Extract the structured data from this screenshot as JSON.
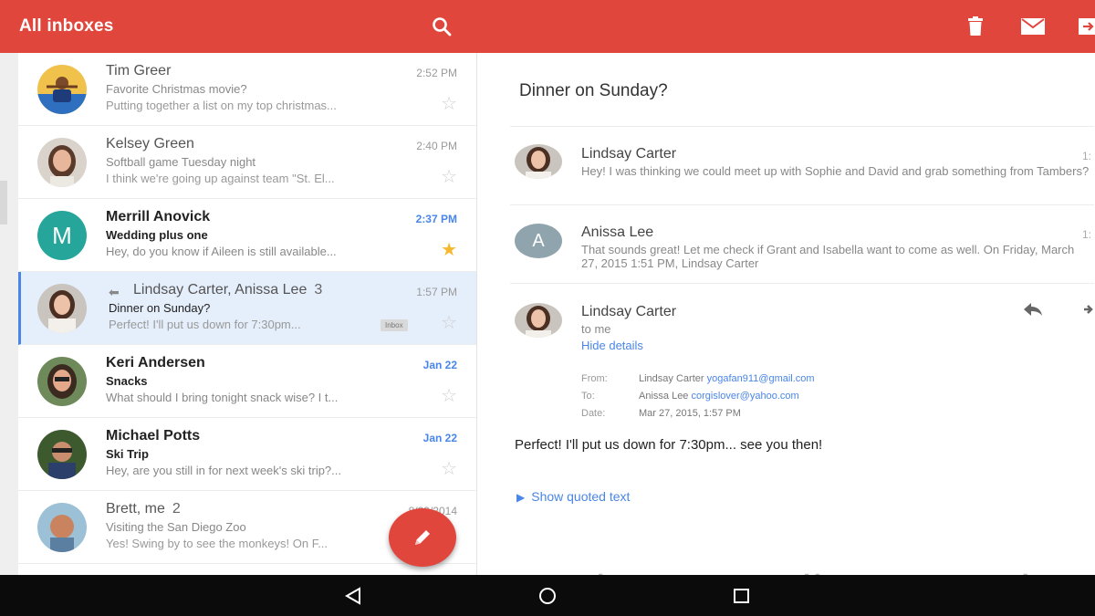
{
  "app_bar": {
    "title": "All inboxes",
    "accent_color": "#e0463c",
    "icons": [
      "search-icon",
      "delete-icon",
      "mark-unread-icon",
      "move-icon"
    ]
  },
  "threads": [
    {
      "sender": "Tim Greer",
      "count": "",
      "time": "2:52 PM",
      "subject": "Favorite Christmas movie?",
      "snippet": "Putting together a list on my top christmas...",
      "unread": false,
      "starred": false,
      "avatar": "photo",
      "chip": ""
    },
    {
      "sender": "Kelsey Green",
      "count": "",
      "time": "2:40 PM",
      "subject": "Softball game Tuesday night",
      "snippet": "I think we're going up against team \"St. El...",
      "unread": false,
      "starred": false,
      "avatar": "photo",
      "chip": ""
    },
    {
      "sender": "Merrill Anovick",
      "count": "",
      "time": "2:37 PM",
      "subject": "Wedding plus one",
      "snippet": "Hey, do you know if Aileen is still available...",
      "unread": true,
      "starred": true,
      "avatar": "M",
      "chip": ""
    },
    {
      "sender": "Lindsay Carter, Anissa Lee",
      "count": "3",
      "time": "1:57 PM",
      "subject": "Dinner on Sunday?",
      "snippet": "Perfect! I'll put us down for 7:30pm...",
      "unread": false,
      "starred": false,
      "avatar": "photo",
      "chip": "Inbox",
      "selected": true
    },
    {
      "sender": "Keri Andersen",
      "count": "",
      "time": "Jan 22",
      "subject": "Snacks",
      "snippet": "What should I bring tonight snack wise? I t...",
      "unread": true,
      "starred": false,
      "avatar": "photo",
      "chip": ""
    },
    {
      "sender": "Michael Potts",
      "count": "",
      "time": "Jan 22",
      "subject": "Ski Trip",
      "snippet": "Hey, are you still in for next week's ski trip?...",
      "unread": true,
      "starred": false,
      "avatar": "photo",
      "chip": ""
    },
    {
      "sender": "Brett, me",
      "count": "2",
      "time": "8/29/2014",
      "subject": "Visiting the San Diego Zoo",
      "snippet": "Yes! Swing by to see the monkeys! On F...",
      "unread": false,
      "starred": false,
      "avatar": "photo",
      "chip": ""
    }
  ],
  "conversation": {
    "subject": "Dinner on Sunday?",
    "messages": [
      {
        "sender": "Lindsay Carter",
        "snippet": "Hey! I was thinking we could meet up with Sophie and David and grab something from Tambers?",
        "time_fragment": "1:"
      },
      {
        "sender": "Anissa Lee",
        "avatar_letter": "A",
        "snippet": "That sounds great! Let me check if Grant and Isabella want to come as well. On Friday, March 27, 2015 1:51 PM, Lindsay Carter",
        "time_fragment": "1:"
      }
    ],
    "expanded": {
      "sender": "Lindsay Carter",
      "to_line": "to me",
      "hide_details": "Hide details",
      "from_label": "From:",
      "from_name": "Lindsay Carter",
      "from_email": "yogafan911@gmail.com",
      "to_label": "To:",
      "to_name": "Anissa Lee",
      "to_email": "corgislover@yahoo.com",
      "date_label": "Date:",
      "date_value": "Mar 27, 2015, 1:57 PM",
      "body": "Perfect! I'll put us down for 7:30pm... see you then!",
      "show_quoted": "Show quoted text"
    }
  },
  "nav_bar": {
    "buttons": [
      "back-icon",
      "home-icon",
      "recents-icon"
    ]
  }
}
